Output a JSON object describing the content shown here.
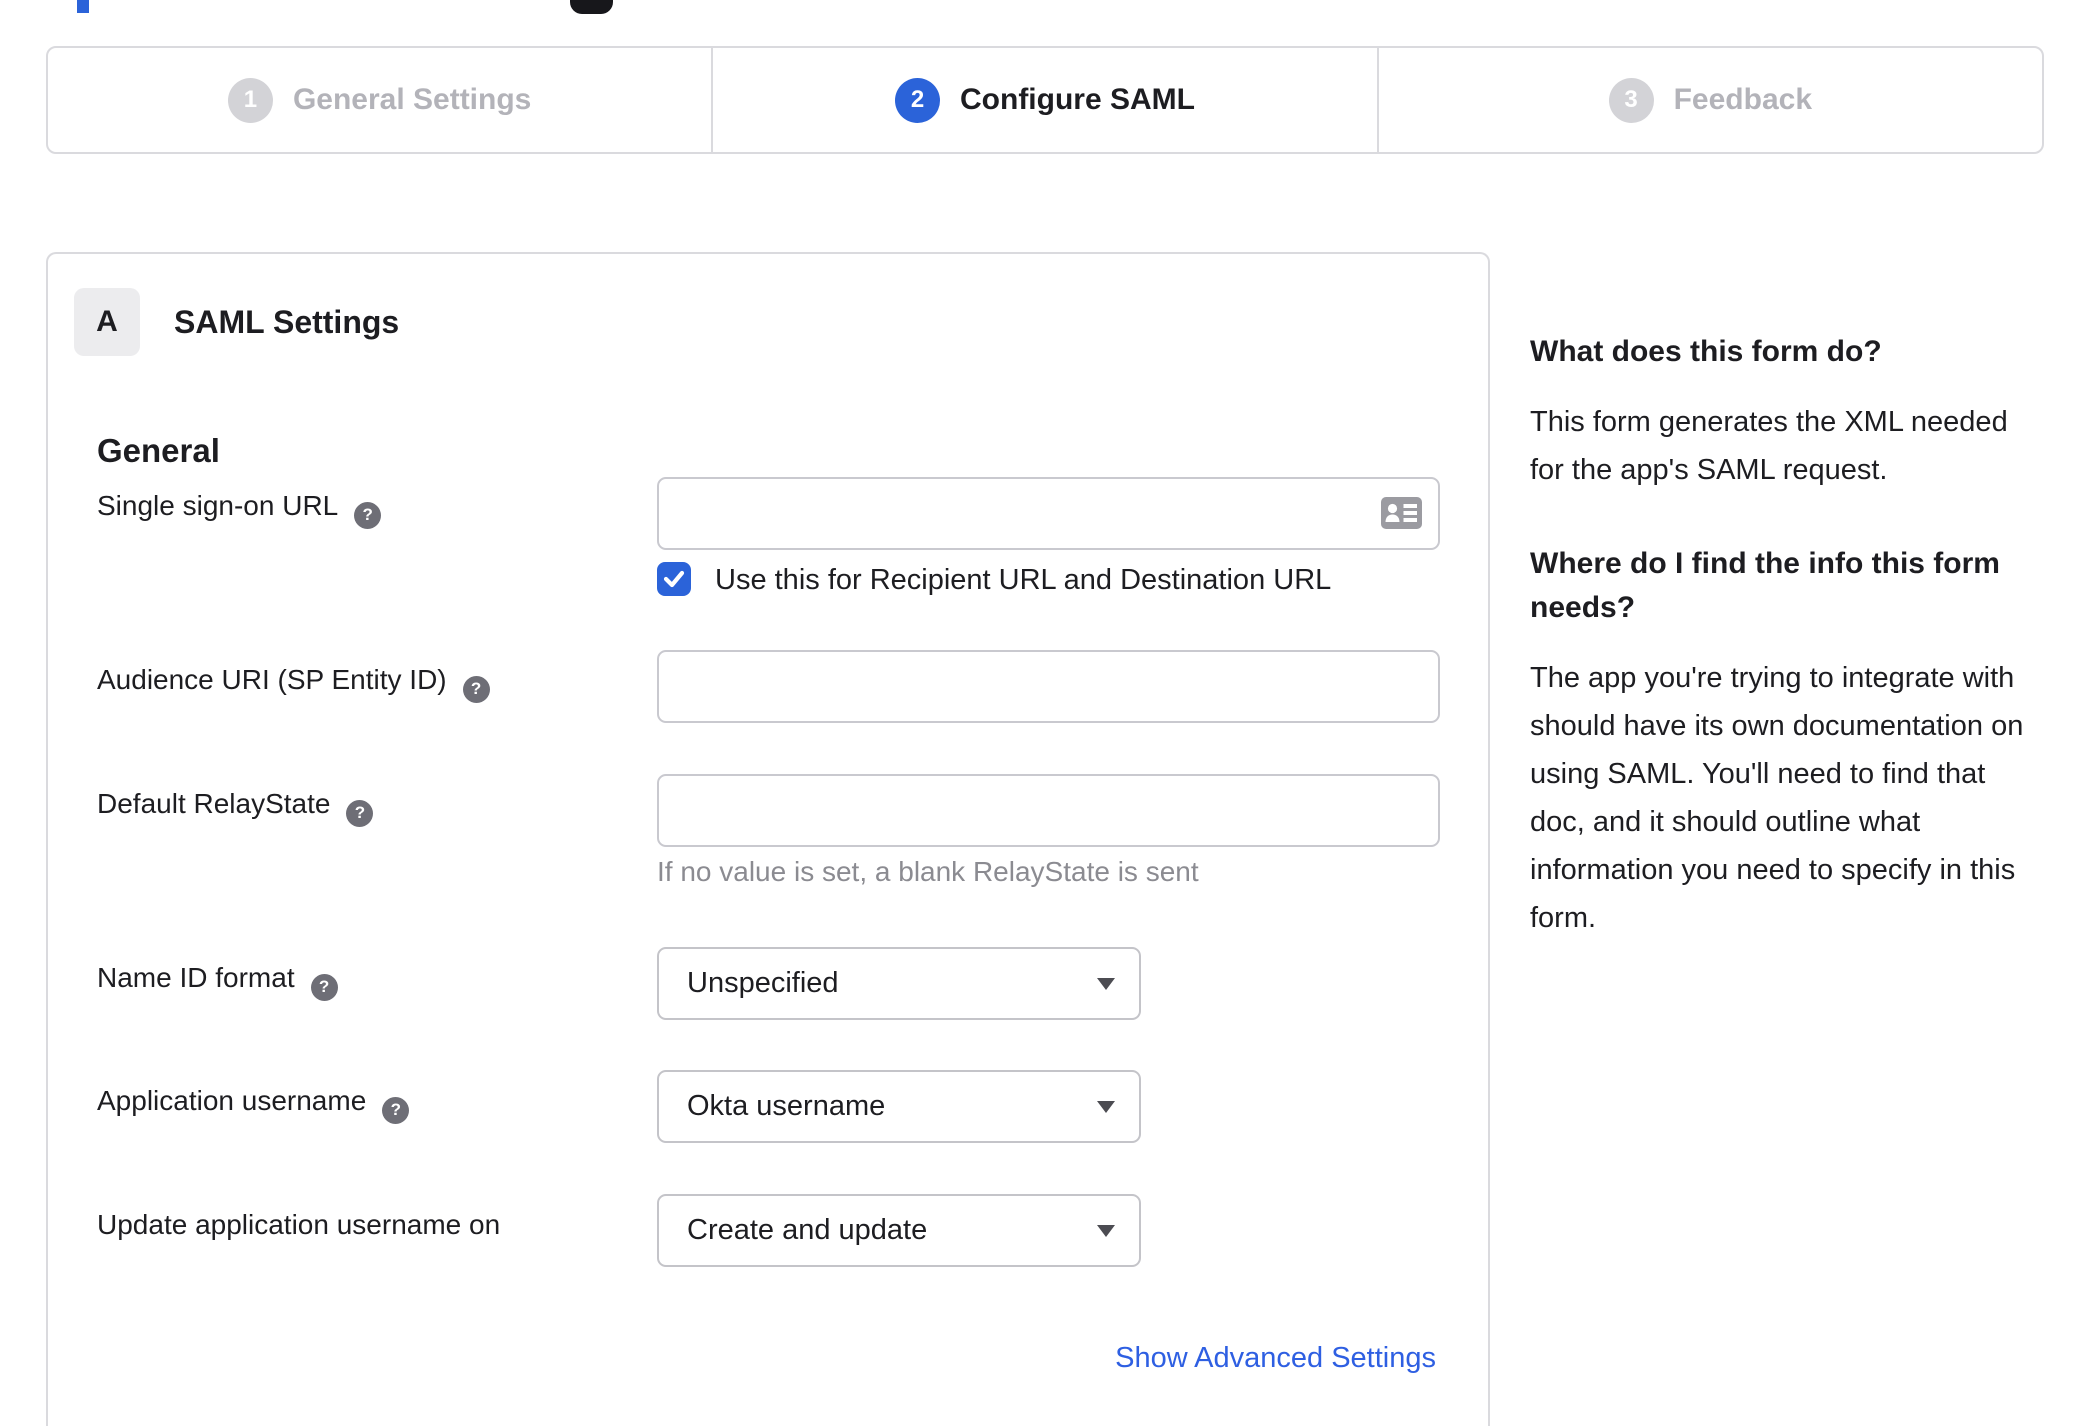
{
  "stepper": {
    "steps": [
      {
        "number": "1",
        "label": "General Settings",
        "state": "inactive"
      },
      {
        "number": "2",
        "label": "Configure SAML",
        "state": "active"
      },
      {
        "number": "3",
        "label": "Feedback",
        "state": "inactive"
      }
    ]
  },
  "saml_panel": {
    "badge": "A",
    "title": "SAML Settings",
    "section": "General",
    "sso_url": {
      "label": "Single sign-on URL",
      "value": ""
    },
    "sso_checkbox": {
      "label": "Use this for Recipient URL and Destination URL",
      "checked": true
    },
    "audience_uri": {
      "label": "Audience URI (SP Entity ID)",
      "value": ""
    },
    "relay_state": {
      "label": "Default RelayState",
      "value": "",
      "hint": "If no value is set, a blank RelayState is sent"
    },
    "name_id_format": {
      "label": "Name ID format",
      "value": "Unspecified"
    },
    "app_username": {
      "label": "Application username",
      "value": "Okta username"
    },
    "update_username": {
      "label": "Update application username on",
      "value": "Create and update"
    },
    "advanced_link": "Show Advanced Settings"
  },
  "help_panel": {
    "q1": "What does this form do?",
    "a1": "This form generates the XML needed for the app's SAML request.",
    "q2": "Where do I find the info this form needs?",
    "a2": "The app you're trying to integrate with should have its own documentation on using SAML. You'll need to find that doc, and it should outline what information you need to specify in this form."
  },
  "colors": {
    "accent_blue": "#2b63d9",
    "link_blue": "#2e5fe2",
    "inactive_gray": "#d3d3d7",
    "border_gray": "#dadade",
    "text_dark": "#1d1d21",
    "muted_text": "#8b8b91",
    "help_icon_gray": "#6e6e76"
  }
}
